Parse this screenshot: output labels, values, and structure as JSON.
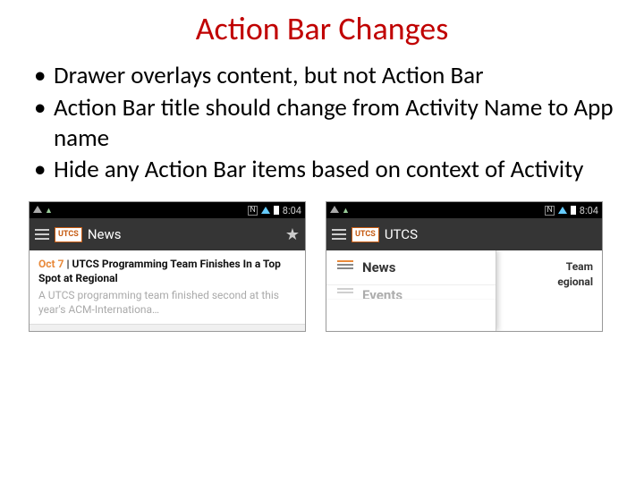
{
  "title": "Action Bar Changes",
  "bullets": [
    "Drawer overlays content, but not Action Bar",
    "Action Bar title should change from Activity Name to App name",
    "Hide any Action Bar items based on context of Activity"
  ],
  "phones": {
    "clock": "8:04",
    "logo_text": "UTCS",
    "left": {
      "actionbar_title": "News",
      "article": {
        "date": "Oct 7",
        "headline": "UTCS Programming Team Finishes In a Top Spot at Regional",
        "summary": "A UTCS programming team finished second at this year's ACM-Internationa…"
      }
    },
    "right": {
      "actionbar_title": "UTCS",
      "drawer_items": [
        "News",
        "Events"
      ],
      "behind_text_1": "Team",
      "behind_text_2": "egional"
    }
  }
}
